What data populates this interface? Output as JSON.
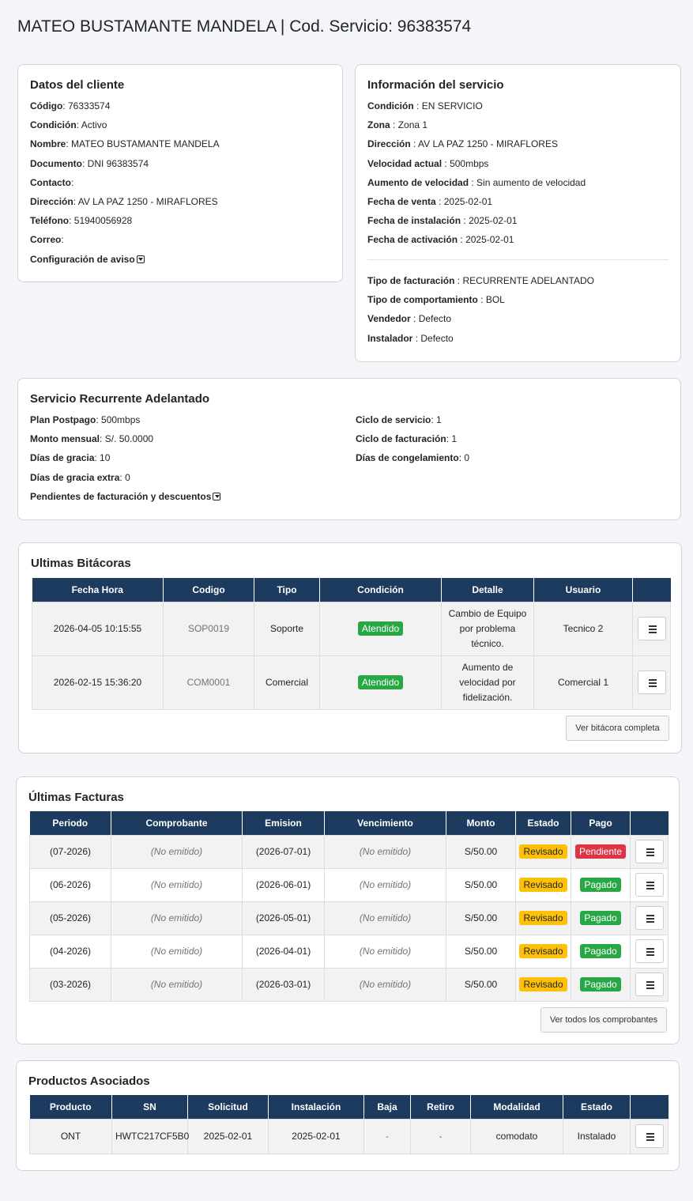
{
  "page_title": "MATEO BUSTAMANTE MANDELA | Cod. Servicio: 96383574",
  "cliente": {
    "title": "Datos del cliente",
    "fields": [
      {
        "label": "Código",
        "sep": ": ",
        "value": "76333574"
      },
      {
        "label": "Condición",
        "sep": ": ",
        "value": "Activo"
      },
      {
        "label": "Nombre",
        "sep": ": ",
        "value": "MATEO BUSTAMANTE MANDELA"
      },
      {
        "label": "Documento",
        "sep": ": ",
        "value": "DNI 96383574"
      },
      {
        "label": "Contacto",
        "sep": ":",
        "value": ""
      },
      {
        "label": "Dirección",
        "sep": ": ",
        "value": "AV LA PAZ 1250 - MIRAFLORES"
      },
      {
        "label": "Teléfono",
        "sep": ": ",
        "value": "51940056928"
      },
      {
        "label": "Correo",
        "sep": ":",
        "value": ""
      }
    ],
    "config_label": "Configuración de aviso"
  },
  "servicio_info": {
    "title": "Información del servicio",
    "fields_a": [
      {
        "label": "Condición",
        "sep": " : ",
        "value": "EN SERVICIO"
      },
      {
        "label": "Zona",
        "sep": " : ",
        "value": "Zona 1"
      },
      {
        "label": "Dirección",
        "sep": " : ",
        "value": "AV LA PAZ 1250 - MIRAFLORES"
      },
      {
        "label": "Velocidad actual",
        "sep": " : ",
        "value": "500mbps"
      },
      {
        "label": "Aumento de velocidad",
        "sep": " : ",
        "value": "Sin aumento de velocidad"
      },
      {
        "label": "Fecha de venta",
        "sep": " : ",
        "value": "2025-02-01"
      },
      {
        "label": "Fecha de instalación",
        "sep": " : ",
        "value": "2025-02-01"
      },
      {
        "label": "Fecha de activación",
        "sep": " : ",
        "value": "2025-02-01"
      }
    ],
    "fields_b": [
      {
        "label": "Tipo de facturación",
        "sep": " : ",
        "value": "RECURRENTE ADELANTADO"
      },
      {
        "label": "Tipo de comportamiento",
        "sep": " : ",
        "value": "BOL"
      },
      {
        "label": "Vendedor",
        "sep": " : ",
        "value": "Defecto"
      },
      {
        "label": "Instalador",
        "sep": " : ",
        "value": "Defecto"
      }
    ]
  },
  "recurrente": {
    "title": "Servicio Recurrente Adelantado",
    "left": [
      {
        "label": "Plan Postpago",
        "sep": ": ",
        "value": "500mbps"
      },
      {
        "label": "Monto mensual",
        "sep": ": ",
        "value": "S/. 50.0000"
      },
      {
        "label": "Días de gracia",
        "sep": ": ",
        "value": "10"
      },
      {
        "label": "Días de gracia extra",
        "sep": ": ",
        "value": "0"
      }
    ],
    "right": [
      {
        "label": "Ciclo de servicio",
        "sep": ": ",
        "value": "1"
      },
      {
        "label": "Ciclo de facturación",
        "sep": ": ",
        "value": "1"
      },
      {
        "label": "Días de congelamiento",
        "sep": ": ",
        "value": "0"
      }
    ],
    "pendientes_label": "Pendientes de facturación y descuentos"
  },
  "bitacoras": {
    "title": "Ultimas Bitácoras",
    "headers": [
      "Fecha Hora",
      "Codigo",
      "Tipo",
      "Condición",
      "Detalle",
      "Usuario",
      ""
    ],
    "rows": [
      {
        "fecha": "2026-04-05 10:15:55",
        "codigo": "SOP0019",
        "tipo": "Soporte",
        "condicion": "Atendido",
        "detalle": "Cambio de Equipo por problema técnico.",
        "usuario": "Tecnico 2"
      },
      {
        "fecha": "2026-02-15 15:36:20",
        "codigo": "COM0001",
        "tipo": "Comercial",
        "condicion": "Atendido",
        "detalle": "Aumento de velocidad por fidelización.",
        "usuario": "Comercial 1"
      }
    ],
    "button": "Ver bitácora completa"
  },
  "facturas": {
    "title": "Últimas Facturas",
    "headers": [
      "Periodo",
      "Comprobante",
      "Emision",
      "Vencimiento",
      "Monto",
      "Estado",
      "Pago",
      ""
    ],
    "rows": [
      {
        "periodo": "(07-2026)",
        "comprobante": "(No emitido)",
        "emision": "(2026-07-01)",
        "vencimiento": "(No emitido)",
        "monto": "S/50.00",
        "estado": "Revisado",
        "pago": "Pendiente"
      },
      {
        "periodo": "(06-2026)",
        "comprobante": "(No emitido)",
        "emision": "(2026-06-01)",
        "vencimiento": "(No emitido)",
        "monto": "S/50.00",
        "estado": "Revisado",
        "pago": "Pagado"
      },
      {
        "periodo": "(05-2026)",
        "comprobante": "(No emitido)",
        "emision": "(2026-05-01)",
        "vencimiento": "(No emitido)",
        "monto": "S/50.00",
        "estado": "Revisado",
        "pago": "Pagado"
      },
      {
        "periodo": "(04-2026)",
        "comprobante": "(No emitido)",
        "emision": "(2026-04-01)",
        "vencimiento": "(No emitido)",
        "monto": "S/50.00",
        "estado": "Revisado",
        "pago": "Pagado"
      },
      {
        "periodo": "(03-2026)",
        "comprobante": "(No emitido)",
        "emision": "(2026-03-01)",
        "vencimiento": "(No emitido)",
        "monto": "S/50.00",
        "estado": "Revisado",
        "pago": "Pagado"
      }
    ],
    "button": "Ver todos los comprobantes"
  },
  "productos": {
    "title": "Productos Asociados",
    "headers": [
      "Producto",
      "SN",
      "Solicitud",
      "Instalación",
      "Baja",
      "Retiro",
      "Modalidad",
      "Estado",
      ""
    ],
    "rows": [
      {
        "producto": "ONT",
        "sn": "HWTC217CF5B0",
        "solicitud": "2025-02-01",
        "instalacion": "2025-02-01",
        "baja": "-",
        "retiro": "-",
        "modalidad": "comodato",
        "estado": "Instalado"
      }
    ]
  },
  "colors": {
    "table_header": "#1d3a5f",
    "badge_green": "#28a745",
    "badge_yellow": "#ffc107",
    "badge_red": "#dc3545"
  },
  "icons": [
    "caret-down-square-icon",
    "hamburger-menu-icon"
  ]
}
